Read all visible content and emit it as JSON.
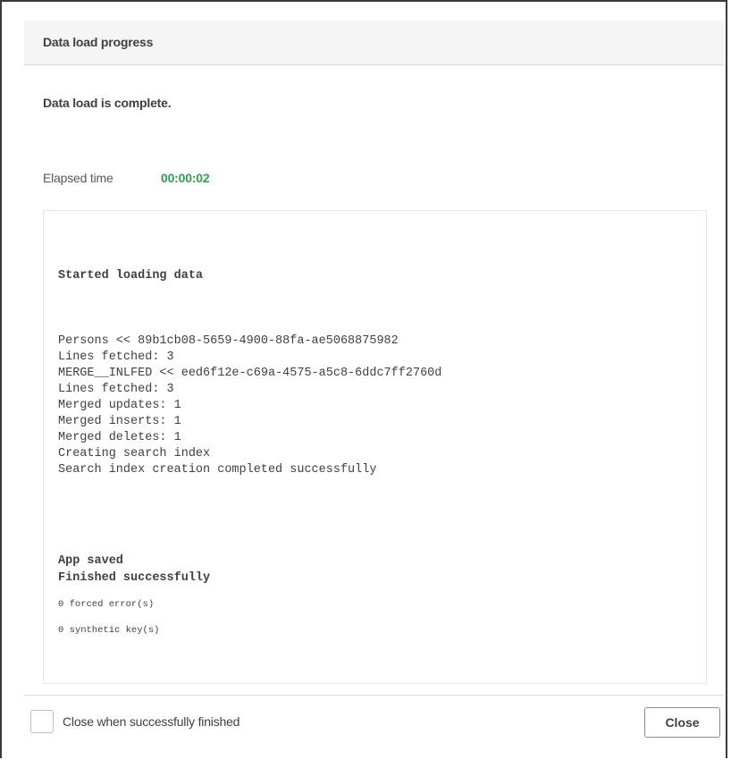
{
  "dialog": {
    "title": "Data load progress",
    "status": "Data load is complete.",
    "elapsed": {
      "label": "Elapsed time",
      "value": "00:00:02",
      "value_color": "#2fa04c"
    }
  },
  "log": {
    "lines": [
      "Started loading data",
      "Persons << 89b1cb08-5659-4900-88fa-ae5068875982",
      "Lines fetched: 3",
      "MERGE__INLFED << eed6f12e-c69a-4575-a5c8-6ddc7ff2760d",
      "Lines fetched: 3",
      "Merged updates: 1",
      "Merged inserts: 1",
      "Merged deletes: 1",
      "Creating search index",
      "Search index creation completed successfully",
      "App saved",
      "Finished successfully",
      "0 forced error(s)",
      "0 synthetic key(s)"
    ]
  },
  "footer": {
    "checkbox_label": "Close when successfully finished",
    "checkbox_checked": false,
    "close_label": "Close"
  }
}
